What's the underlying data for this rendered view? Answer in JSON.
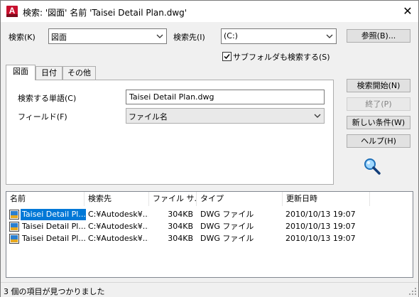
{
  "window": {
    "title": "検索: '図面' 名前 'Taisei Detail Plan.dwg'",
    "app_icon_letter": "A",
    "close_glyph": "✕"
  },
  "search_bar": {
    "type_label": "検索(K)",
    "type_value": "図面",
    "location_label": "検索先(I)",
    "location_value": "(C:)",
    "browse_button": "参照(B)...",
    "subfolder_label": "サブフォルダも検索する(S)",
    "subfolder_checked": true
  },
  "tabs": [
    {
      "label": "図面",
      "active": true
    },
    {
      "label": "日付",
      "active": false
    },
    {
      "label": "その他",
      "active": false
    }
  ],
  "drawing_tab": {
    "search_words_label": "検索する単語(C)",
    "search_words_value": "Taisei Detail Plan.dwg",
    "field_label": "フィールド(F)",
    "field_value": "ファイル名"
  },
  "actions": {
    "start_search": "検索開始(N)",
    "stop": "終了(P)",
    "new_search": "新しい条件(W)",
    "help": "ヘルプ(H)"
  },
  "results": {
    "columns": [
      "名前",
      "検索先",
      "ファイル サ...",
      "タイプ",
      "更新日時"
    ],
    "rows": [
      {
        "name": "Taisei Detail Pl...",
        "location": "C:¥Autodesk¥...",
        "size": "304KB",
        "type": "DWG ファイル",
        "modified": "2010/10/13 19:07",
        "selected": true
      },
      {
        "name": "Taisei Detail Pl...",
        "location": "C:¥Autodesk¥...",
        "size": "304KB",
        "type": "DWG ファイル",
        "modified": "2010/10/13 19:07",
        "selected": false
      },
      {
        "name": "Taisei Detail Pl...",
        "location": "C:¥Autodesk¥...",
        "size": "304KB",
        "type": "DWG ファイル",
        "modified": "2010/10/13 19:07",
        "selected": false
      }
    ]
  },
  "status": {
    "text": "3 個の項目が見つかりました"
  },
  "colors": {
    "selection": "#0078d7",
    "app_icon": "#c8102e",
    "magnifier": "#1e90ff"
  }
}
